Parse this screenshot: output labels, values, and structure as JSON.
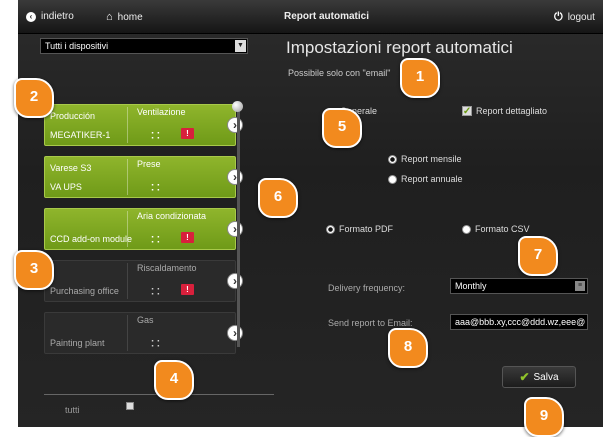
{
  "topbar": {
    "back_label": "indietro",
    "home_label": "home",
    "title": "Report automatici",
    "logout_label": "logout"
  },
  "left": {
    "device_select_value": "Tutti i dispositivi",
    "cards": [
      {
        "name": "Producción",
        "sub": "MEGATIKER-1",
        "func": "Ventilazione",
        "active": true,
        "alert": true
      },
      {
        "name": "Varese S3",
        "sub": "VA UPS",
        "func": "Prese",
        "active": true,
        "alert": false
      },
      {
        "name": "",
        "sub": "CCD add-on module",
        "func": "Aria condizionata",
        "active": true,
        "alert": true
      },
      {
        "name": "",
        "sub": "Purchasing office",
        "func": "Riscaldamento",
        "active": false,
        "alert": true
      },
      {
        "name": "",
        "sub": "Painting plant",
        "func": "Gas",
        "active": false,
        "alert": false
      }
    ],
    "alert_text": "!",
    "all_label": "tutti"
  },
  "right": {
    "title": "Impostazioni report automatici",
    "subtitle": "Possibile solo con \"email\"",
    "option_general": "Generale",
    "option_detailed": "Report dettagliato",
    "option_monthly": "Report mensile",
    "option_annual": "Report annuale",
    "option_pdf": "Formato PDF",
    "option_csv": "Formato CSV",
    "delivery_label": "Delivery frequency:",
    "delivery_value": "Monthly",
    "email_label": "Send report to Email:",
    "email_value": "aaa@bbb.xy,ccc@ddd.wz,eee@",
    "save_label": "Salva"
  },
  "callouts": [
    "1",
    "2",
    "3",
    "4",
    "5",
    "6",
    "7",
    "8",
    "9"
  ],
  "colors": {
    "active_card": "#7fa622",
    "callout": "#f28a1e",
    "alert": "#d8203c"
  }
}
